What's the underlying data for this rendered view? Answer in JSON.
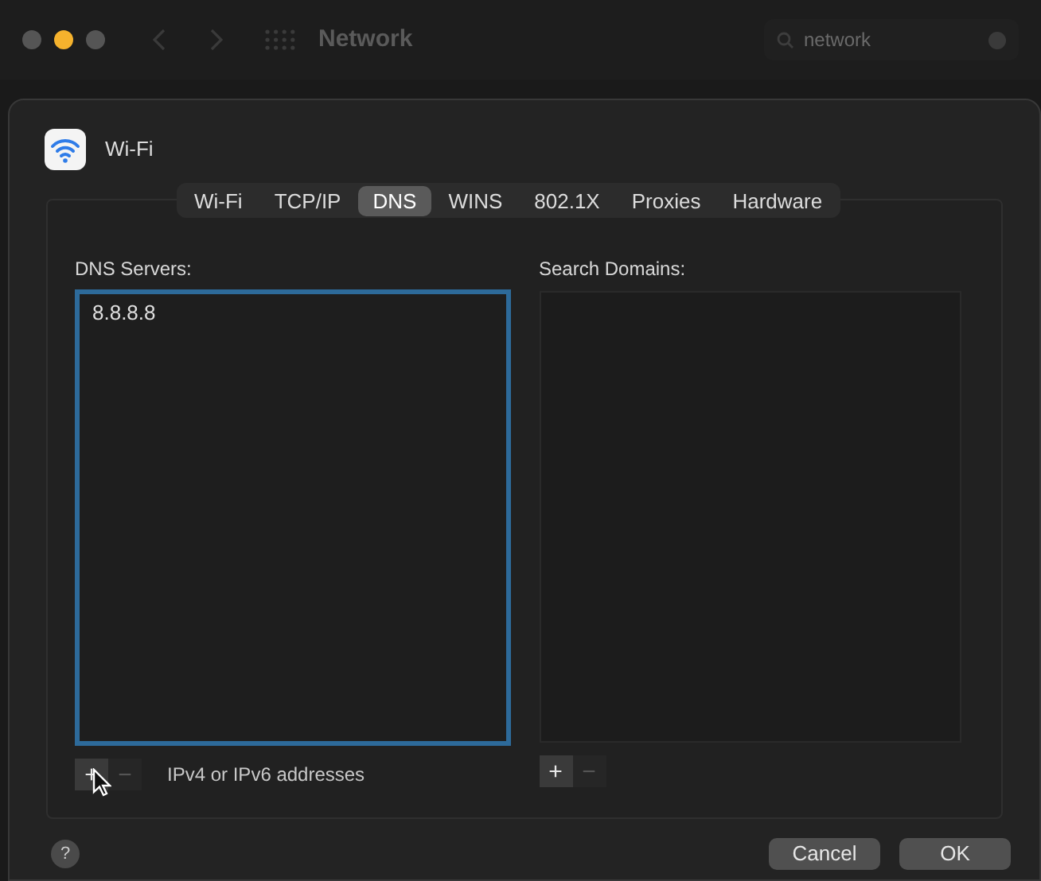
{
  "window": {
    "title": "Network",
    "search": {
      "value": "network"
    }
  },
  "interface": {
    "name": "Wi-Fi"
  },
  "tabs": [
    {
      "label": "Wi-Fi",
      "selected": false
    },
    {
      "label": "TCP/IP",
      "selected": false
    },
    {
      "label": "DNS",
      "selected": true
    },
    {
      "label": "WINS",
      "selected": false
    },
    {
      "label": "802.1X",
      "selected": false
    },
    {
      "label": "Proxies",
      "selected": false
    },
    {
      "label": "Hardware",
      "selected": false
    }
  ],
  "dns_servers": {
    "label": "DNS Servers:",
    "focused": true,
    "items": [
      "8.8.8.8"
    ],
    "add": {
      "label": "+",
      "disabled": false
    },
    "remove": {
      "label": "−",
      "disabled": true
    },
    "hint": "IPv4 or IPv6 addresses"
  },
  "search_domains": {
    "label": "Search Domains:",
    "focused": false,
    "add": {
      "label": "+",
      "disabled": false
    },
    "remove": {
      "label": "−",
      "disabled": true
    }
  },
  "help": {
    "label": "?"
  },
  "buttons": [
    {
      "label": "Cancel",
      "default": false
    },
    {
      "label": "OK",
      "default": false
    }
  ]
}
